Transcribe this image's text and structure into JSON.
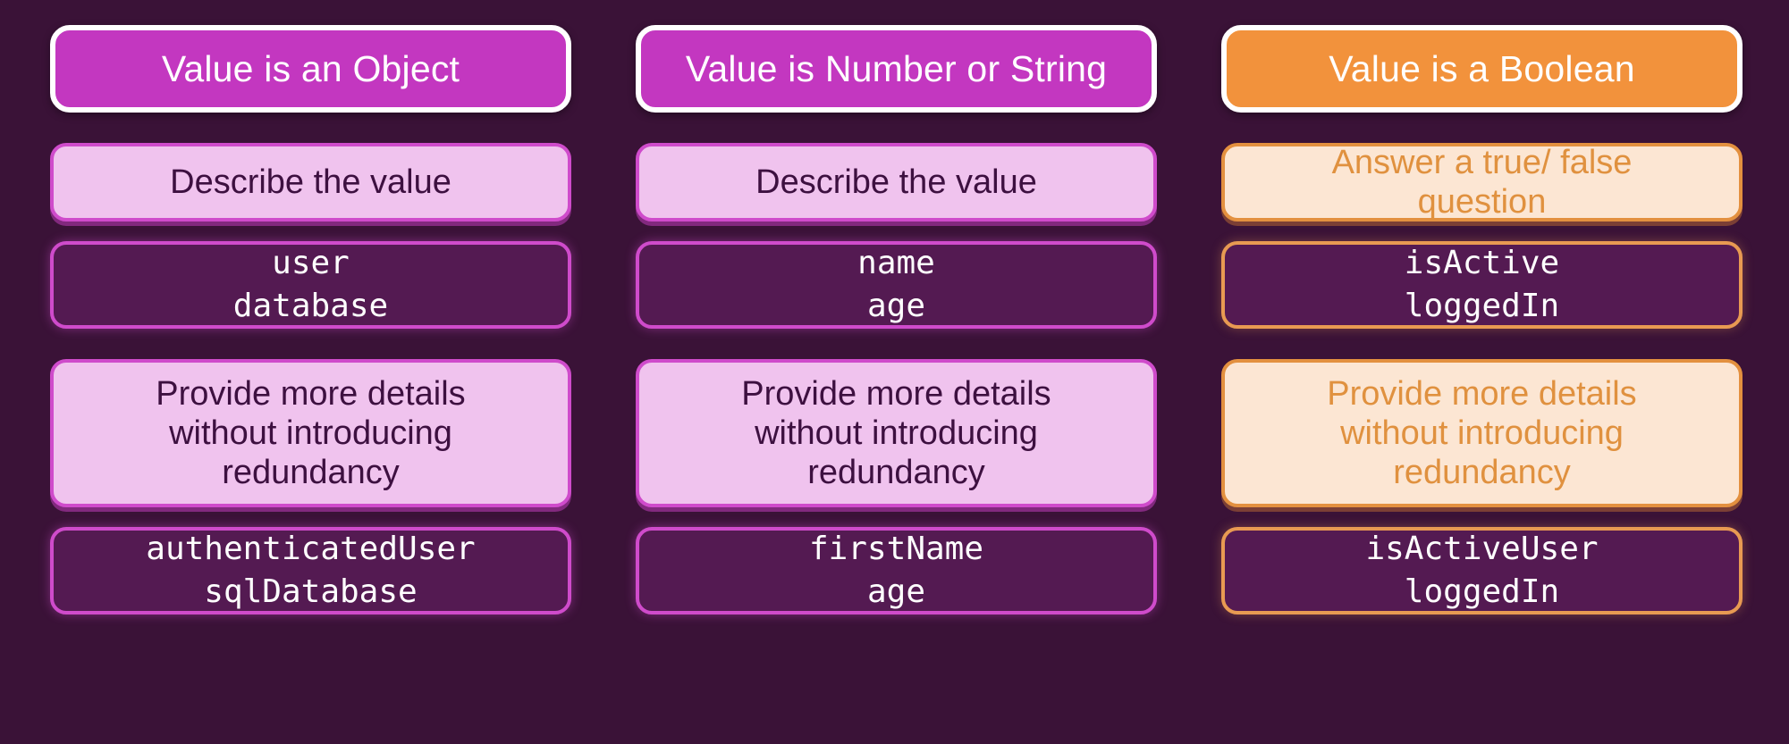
{
  "theme": {
    "background": "#3a1237",
    "magenta_header": "#c337c0",
    "orange_header": "#f2923c",
    "magenta_light": "#f0c3ee",
    "orange_light": "#fce6d3",
    "code_background": "#541a52",
    "magenta_border": "#cf4bcb",
    "orange_border": "#e89a52",
    "header_text": "#ffffff",
    "magenta_text": "#3d1040",
    "orange_text": "#e0913f",
    "code_text": "#ffffff"
  },
  "columns": [
    {
      "id": "object",
      "accent": "magenta",
      "header": "Value is an Object",
      "rule_primary": {
        "lines": [
          "Describe the value"
        ]
      },
      "example_primary": {
        "lines": [
          "user",
          "database"
        ]
      },
      "rule_secondary": {
        "lines": [
          "Provide more details",
          "without introducing",
          "redundancy"
        ]
      },
      "example_secondary": {
        "lines": [
          "authenticatedUser",
          "sqlDatabase"
        ]
      }
    },
    {
      "id": "number-or-string",
      "accent": "magenta",
      "header": "Value is Number or String",
      "rule_primary": {
        "lines": [
          "Describe the value"
        ]
      },
      "example_primary": {
        "lines": [
          "name",
          "age"
        ]
      },
      "rule_secondary": {
        "lines": [
          "Provide more details",
          "without introducing",
          "redundancy"
        ]
      },
      "example_secondary": {
        "lines": [
          "firstName",
          "age"
        ]
      }
    },
    {
      "id": "boolean",
      "accent": "orange",
      "header": "Value is a Boolean",
      "rule_primary": {
        "lines": [
          "Answer a true/ false",
          "question"
        ]
      },
      "example_primary": {
        "lines": [
          "isActive",
          "loggedIn"
        ]
      },
      "rule_secondary": {
        "lines": [
          "Provide more details",
          "without introducing",
          "redundancy"
        ]
      },
      "example_secondary": {
        "lines": [
          "isActiveUser",
          "loggedIn"
        ]
      }
    }
  ]
}
